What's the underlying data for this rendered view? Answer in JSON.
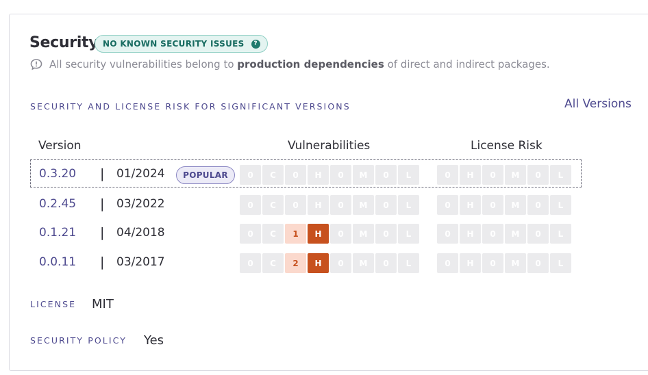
{
  "security": {
    "title": "Security",
    "badge": "NO KNOWN SECURITY ISSUES",
    "badge_help": "?",
    "info_prefix": "All security vulnerabilities belong to",
    "info_bold": "production dependencies",
    "info_suffix": "of direct and indirect packages."
  },
  "risk": {
    "section_label": "SECURITY AND LICENSE RISK FOR SIGNIFICANT VERSIONS",
    "all_versions": "All Versions",
    "columns": {
      "version": "Version",
      "vulnerabilities": "Vulnerabilities",
      "license_risk": "License Risk"
    },
    "popular_label": "POPULAR",
    "separator": "|",
    "rows": [
      {
        "version": "0.3.20",
        "date": "01/2024",
        "popular": true,
        "vuln": [
          {
            "n": "0",
            "l": "C"
          },
          {
            "n": "0",
            "l": "H"
          },
          {
            "n": "0",
            "l": "M"
          },
          {
            "n": "0",
            "l": "L"
          }
        ],
        "license": [
          {
            "n": "0",
            "l": "H"
          },
          {
            "n": "0",
            "l": "M"
          },
          {
            "n": "0",
            "l": "L"
          }
        ]
      },
      {
        "version": "0.2.45",
        "date": "03/2022",
        "popular": false,
        "vuln": [
          {
            "n": "0",
            "l": "C"
          },
          {
            "n": "0",
            "l": "H"
          },
          {
            "n": "0",
            "l": "M"
          },
          {
            "n": "0",
            "l": "L"
          }
        ],
        "license": [
          {
            "n": "0",
            "l": "H"
          },
          {
            "n": "0",
            "l": "M"
          },
          {
            "n": "0",
            "l": "L"
          }
        ]
      },
      {
        "version": "0.1.21",
        "date": "04/2018",
        "popular": false,
        "vuln": [
          {
            "n": "0",
            "l": "C"
          },
          {
            "n": "1",
            "l": "H"
          },
          {
            "n": "0",
            "l": "M"
          },
          {
            "n": "0",
            "l": "L"
          }
        ],
        "license": [
          {
            "n": "0",
            "l": "H"
          },
          {
            "n": "0",
            "l": "M"
          },
          {
            "n": "0",
            "l": "L"
          }
        ]
      },
      {
        "version": "0.0.11",
        "date": "03/2017",
        "popular": false,
        "vuln": [
          {
            "n": "0",
            "l": "C"
          },
          {
            "n": "2",
            "l": "H"
          },
          {
            "n": "0",
            "l": "M"
          },
          {
            "n": "0",
            "l": "L"
          }
        ],
        "license": [
          {
            "n": "0",
            "l": "H"
          },
          {
            "n": "0",
            "l": "M"
          },
          {
            "n": "0",
            "l": "L"
          }
        ]
      }
    ]
  },
  "meta": {
    "license_label": "LICENSE",
    "license_value": "MIT",
    "policy_label": "SECURITY POLICY",
    "policy_value": "Yes"
  },
  "colors": {
    "accent": "#4e4a8f",
    "badge_teal": "#176b60",
    "high_severity": "#c7511e",
    "high_severity_light": "#fbd9cd",
    "empty_cell": "#ebebed"
  },
  "icons": {
    "info": "speech-bubble-info-icon",
    "help": "question-mark-icon"
  }
}
